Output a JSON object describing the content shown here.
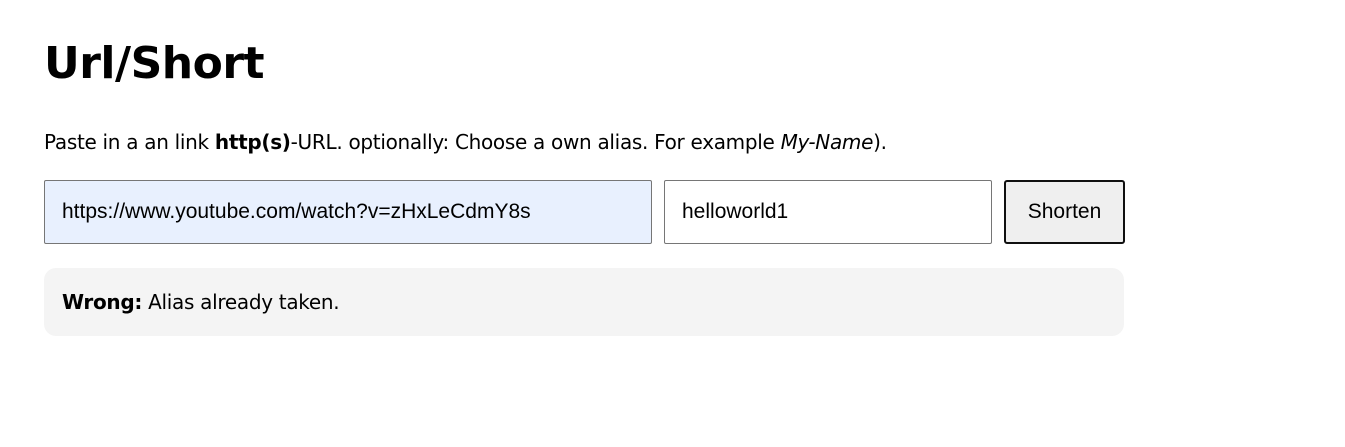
{
  "page": {
    "title": "Url/Short",
    "intro": {
      "part1": "Paste in a an link ",
      "bold": "http(s)",
      "part2": "-URL. optionally: Choose a own alias. For example ",
      "italic": "My-Name",
      "part3": ")."
    }
  },
  "form": {
    "url_value": "https://www.youtube.com/watch?v=zHxLeCdmY8s",
    "alias_value": "helloworld1",
    "submit_label": "Shorten"
  },
  "message": {
    "label": "Wrong:",
    "text": " Alias already taken."
  },
  "colors": {
    "autofill_bg": "#e8f0fe",
    "message_bg": "#f4f4f4"
  }
}
